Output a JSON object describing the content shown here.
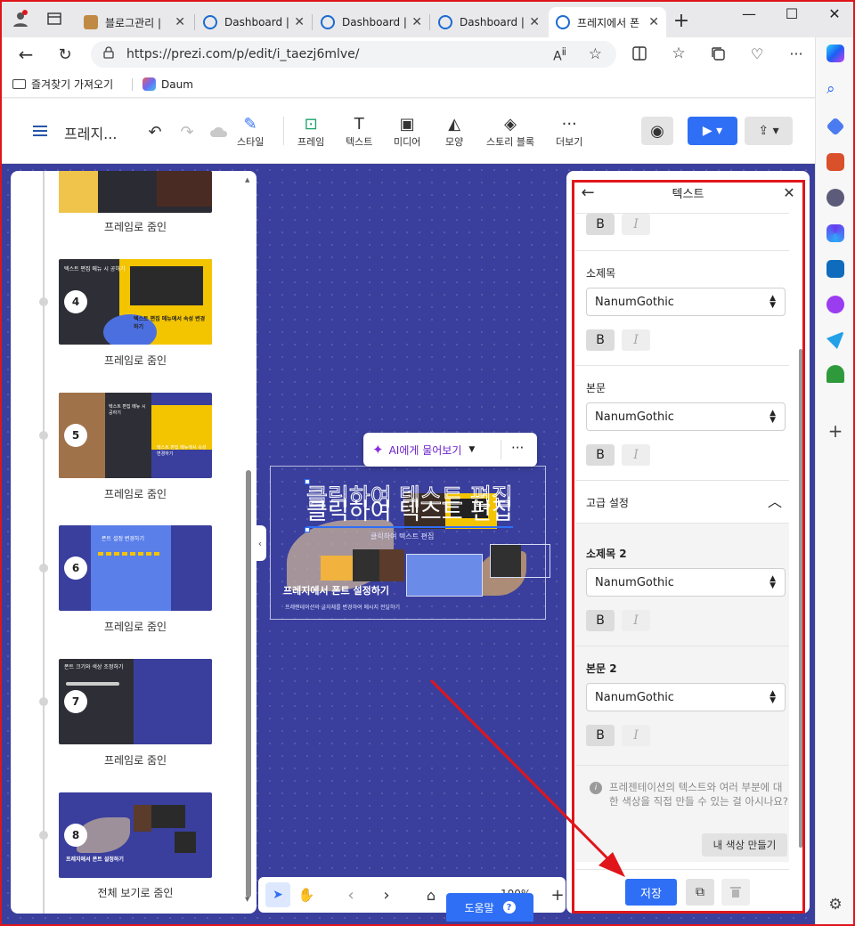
{
  "browser": {
    "tabs": [
      {
        "title": "블로그관리 |",
        "color": "#c08a45"
      },
      {
        "title": "Dashboard |",
        "color": "#1b6bd1"
      },
      {
        "title": "Dashboard |",
        "color": "#1b6bd1"
      },
      {
        "title": "Dashboard |",
        "color": "#1b6bd1"
      },
      {
        "title": "프레지에서 폰",
        "color": "#1b6bd1"
      }
    ],
    "url": "https://prezi.com/p/edit/i_taezj6mlve/",
    "favorites": [
      {
        "label": "즐겨찾기 가져오기"
      },
      {
        "label": "Daum"
      }
    ]
  },
  "prezi": {
    "title": "프레지...",
    "tools": [
      {
        "label": "스타일"
      },
      {
        "label": "프레임"
      },
      {
        "label": "텍스트"
      },
      {
        "label": "미디어"
      },
      {
        "label": "모양"
      },
      {
        "label": "스토리 블록"
      },
      {
        "label": "더보기"
      }
    ],
    "frames": [
      {
        "label": "프레임로 줌인"
      },
      {
        "number": "4",
        "label": "프레임로 줌인",
        "caption": "텍스트 편집 메뉴 시 공하기",
        "subcaption": "텍스트 편집 메뉴에서 속성 변경하기"
      },
      {
        "number": "5",
        "label": "프레임로 줌인",
        "caption": "텍스트 편집 메뉴 시 공하기",
        "subcaption": "텍스트 편집 메뉴에서 속성 변경하기"
      },
      {
        "number": "6",
        "label": "프레임로 줌인",
        "caption": "폰트 설정 변경하기"
      },
      {
        "number": "7",
        "label": "프레임로 줌인",
        "caption": "폰트 크기와 색상 조정하기"
      },
      {
        "number": "8",
        "label": "전체 보기로 줌인",
        "caption": "프레지에서 폰트 설정하기"
      }
    ],
    "ai_button": "AI에게 물어보기",
    "slide": {
      "big_text": "클릭하여 텍스트 편집",
      "small_text": "클릭하여 텍스트 편집",
      "title": "프레지에서 폰트 설정하기",
      "subtitle": "프레젠테이션의 글자체를 변경하여 메시지 전달하기"
    },
    "help_label": "도움말",
    "zoom": "100%"
  },
  "text_panel": {
    "header": "텍스트",
    "sections": [
      {
        "label": "소제목",
        "font": "NanumGothic"
      },
      {
        "label": "본문",
        "font": "NanumGothic"
      },
      {
        "label": "소제목 2",
        "font": "NanumGothic"
      },
      {
        "label": "본문 2",
        "font": "NanumGothic"
      }
    ],
    "advanced": "고급 설정",
    "info": "프레젠테이션의 텍스트와 여러 부분에 대한 색상을 직접 만들 수 있는 걸 아시나요?",
    "make_color": "내 색상 만들기",
    "save": "저장"
  }
}
